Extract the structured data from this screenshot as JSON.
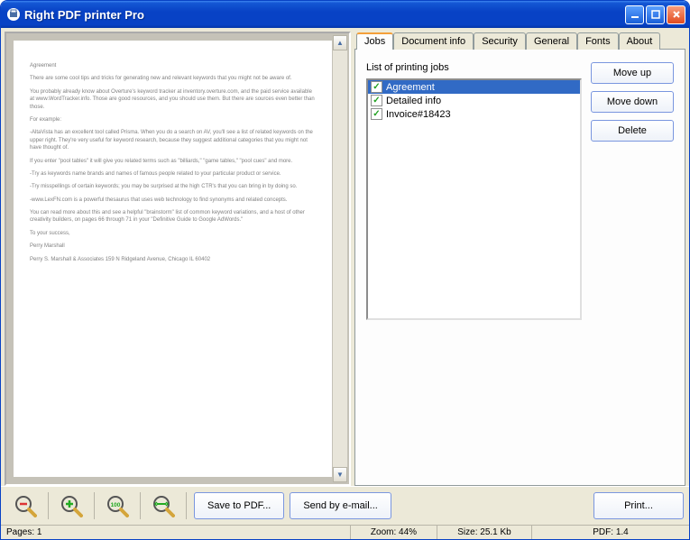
{
  "window": {
    "title": "Right PDF printer Pro"
  },
  "tabs": [
    "Jobs",
    "Document info",
    "Security",
    "General",
    "Fonts",
    "About"
  ],
  "activeTab": 0,
  "jobs": {
    "label": "List of printing jobs",
    "items": [
      {
        "name": "Agreement",
        "checked": true,
        "selected": true
      },
      {
        "name": "Detailed info",
        "checked": true,
        "selected": false
      },
      {
        "name": "Invoice#18423",
        "checked": true,
        "selected": false
      }
    ]
  },
  "buttons": {
    "moveup": "Move up",
    "movedown": "Move down",
    "delete": "Delete",
    "savepdf": "Save to PDF...",
    "sendemail": "Send by e-mail...",
    "print": "Print..."
  },
  "status": {
    "pages": "Pages: 1",
    "zoom": "Zoom: 44%",
    "size": "Size: 25.1 Kb",
    "pdf": "PDF: 1.4"
  },
  "preview": {
    "title": "Agreement",
    "lines": [
      "There are some cool tips and tricks for generating new and relevant keywords that you might not be aware of.",
      "You probably already know about Overture's keyword tracker at inventory.overture.com, and the paid service available at www.WordTracker.info. Those are good resources, and you should use them. But there are sources even better than those.",
      "For example:",
      "-AltaVista has an excellent tool called Prisma. When you do a search on AV, you'll see a list of related keywords on the upper right. They're very useful for keyword research, because they suggest additional categories that you might not have thought of.",
      "If you enter \"pool tables\" it will give you related terms such as \"billiards,\" \"game tables,\" \"pool cues\" and more.",
      "-Try as keywords name brands and names of famous people related to your particular product or service.",
      "-Try misspellings of certain keywords; you may be surprised at the high CTR's that you can bring in by doing so.",
      "-www.LexFN.com is a powerful thesaurus that uses web technology to find synonyms and related concepts.",
      "You can read more about this and see a helpful \"brainstorm\" list of common keyword variations, and a host of other creativity builders, on pages 66 through 71 in your \"Definitive Guide to Google AdWords.\"",
      "To your success,",
      "Perry Marshall",
      "Perry S. Marshall & Associates 159 N Ridgeland Avenue, Chicago IL 60402"
    ]
  }
}
